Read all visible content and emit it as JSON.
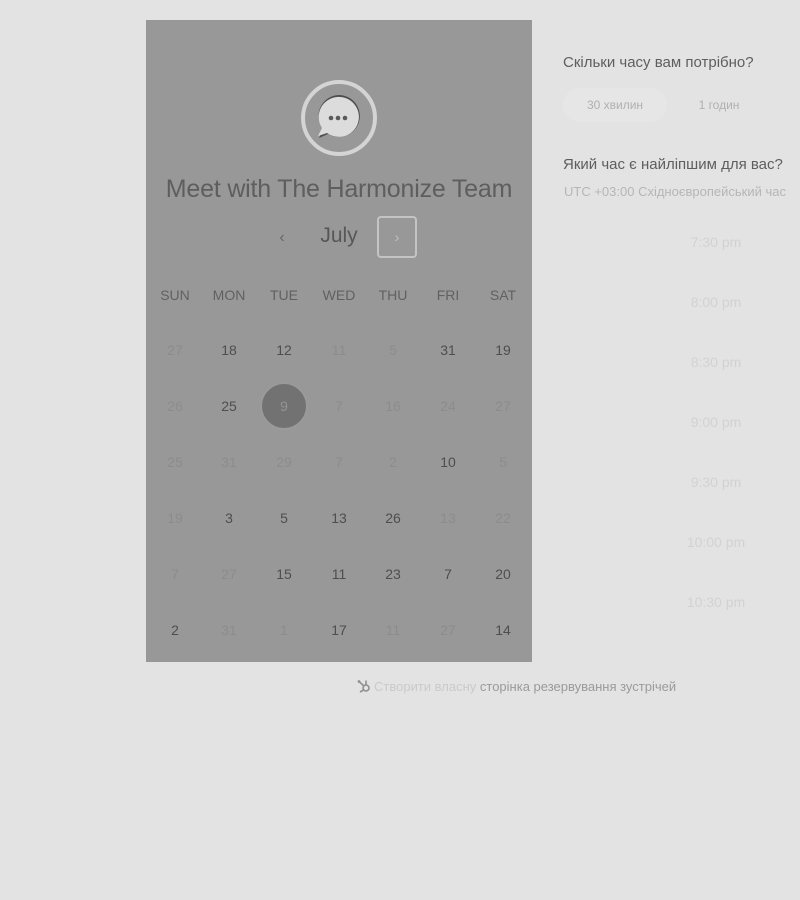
{
  "calendar": {
    "title": "Meet with The Harmonize Team",
    "month": "July",
    "prev_icon": "‹",
    "next_icon": "›",
    "weekdays": [
      "SUN",
      "MON",
      "TUE",
      "WED",
      "THU",
      "FRI",
      "SAT"
    ],
    "weeks": [
      [
        {
          "d": "27",
          "on": false
        },
        {
          "d": "18",
          "on": true
        },
        {
          "d": "12",
          "on": true
        },
        {
          "d": "11",
          "on": false
        },
        {
          "d": "5",
          "on": false
        },
        {
          "d": "31",
          "on": true
        },
        {
          "d": "19",
          "on": true
        }
      ],
      [
        {
          "d": "26",
          "on": false
        },
        {
          "d": "25",
          "on": true
        },
        {
          "d": "9",
          "on": true,
          "selected": true
        },
        {
          "d": "7",
          "on": false
        },
        {
          "d": "16",
          "on": false
        },
        {
          "d": "24",
          "on": false
        },
        {
          "d": "27",
          "on": false
        }
      ],
      [
        {
          "d": "25",
          "on": false
        },
        {
          "d": "31",
          "on": false
        },
        {
          "d": "29",
          "on": false
        },
        {
          "d": "7",
          "on": false
        },
        {
          "d": "2",
          "on": false
        },
        {
          "d": "10",
          "on": true
        },
        {
          "d": "5",
          "on": false
        }
      ],
      [
        {
          "d": "19",
          "on": false
        },
        {
          "d": "3",
          "on": true
        },
        {
          "d": "5",
          "on": true
        },
        {
          "d": "13",
          "on": true
        },
        {
          "d": "26",
          "on": true
        },
        {
          "d": "13",
          "on": false
        },
        {
          "d": "22",
          "on": false
        }
      ],
      [
        {
          "d": "7",
          "on": false
        },
        {
          "d": "27",
          "on": false
        },
        {
          "d": "15",
          "on": true
        },
        {
          "d": "11",
          "on": true
        },
        {
          "d": "23",
          "on": true
        },
        {
          "d": "7",
          "on": true
        },
        {
          "d": "20",
          "on": true
        }
      ],
      [
        {
          "d": "2",
          "on": true
        },
        {
          "d": "31",
          "on": false
        },
        {
          "d": "1",
          "on": false
        },
        {
          "d": "17",
          "on": true
        },
        {
          "d": "11",
          "on": false
        },
        {
          "d": "27",
          "on": false
        },
        {
          "d": "14",
          "on": true
        }
      ]
    ]
  },
  "duration": {
    "heading": "Скільки часу вам потрібно?",
    "options": [
      "30 хвилин",
      "1 годин"
    ]
  },
  "time": {
    "heading": "Який час є найліпшим для вас?",
    "timezone": "UTC +03:00 Східноєвропейський час",
    "slots": [
      "7:30 pm",
      "8:00 pm",
      "8:30 pm",
      "9:00 pm",
      "9:30 pm",
      "10:00 pm",
      "10:30 pm"
    ]
  },
  "footer": {
    "prefix": "Створити власну",
    "link": "сторінка резервування зустрічей"
  },
  "colors": {
    "page_bg": "#e3e3e3",
    "panel_bg": "#989898",
    "selected_day": "#727272"
  },
  "icons": [
    "chat-bubble-icon",
    "chevron-left-icon",
    "chevron-right-icon",
    "hubspot-sprocket-icon"
  ]
}
